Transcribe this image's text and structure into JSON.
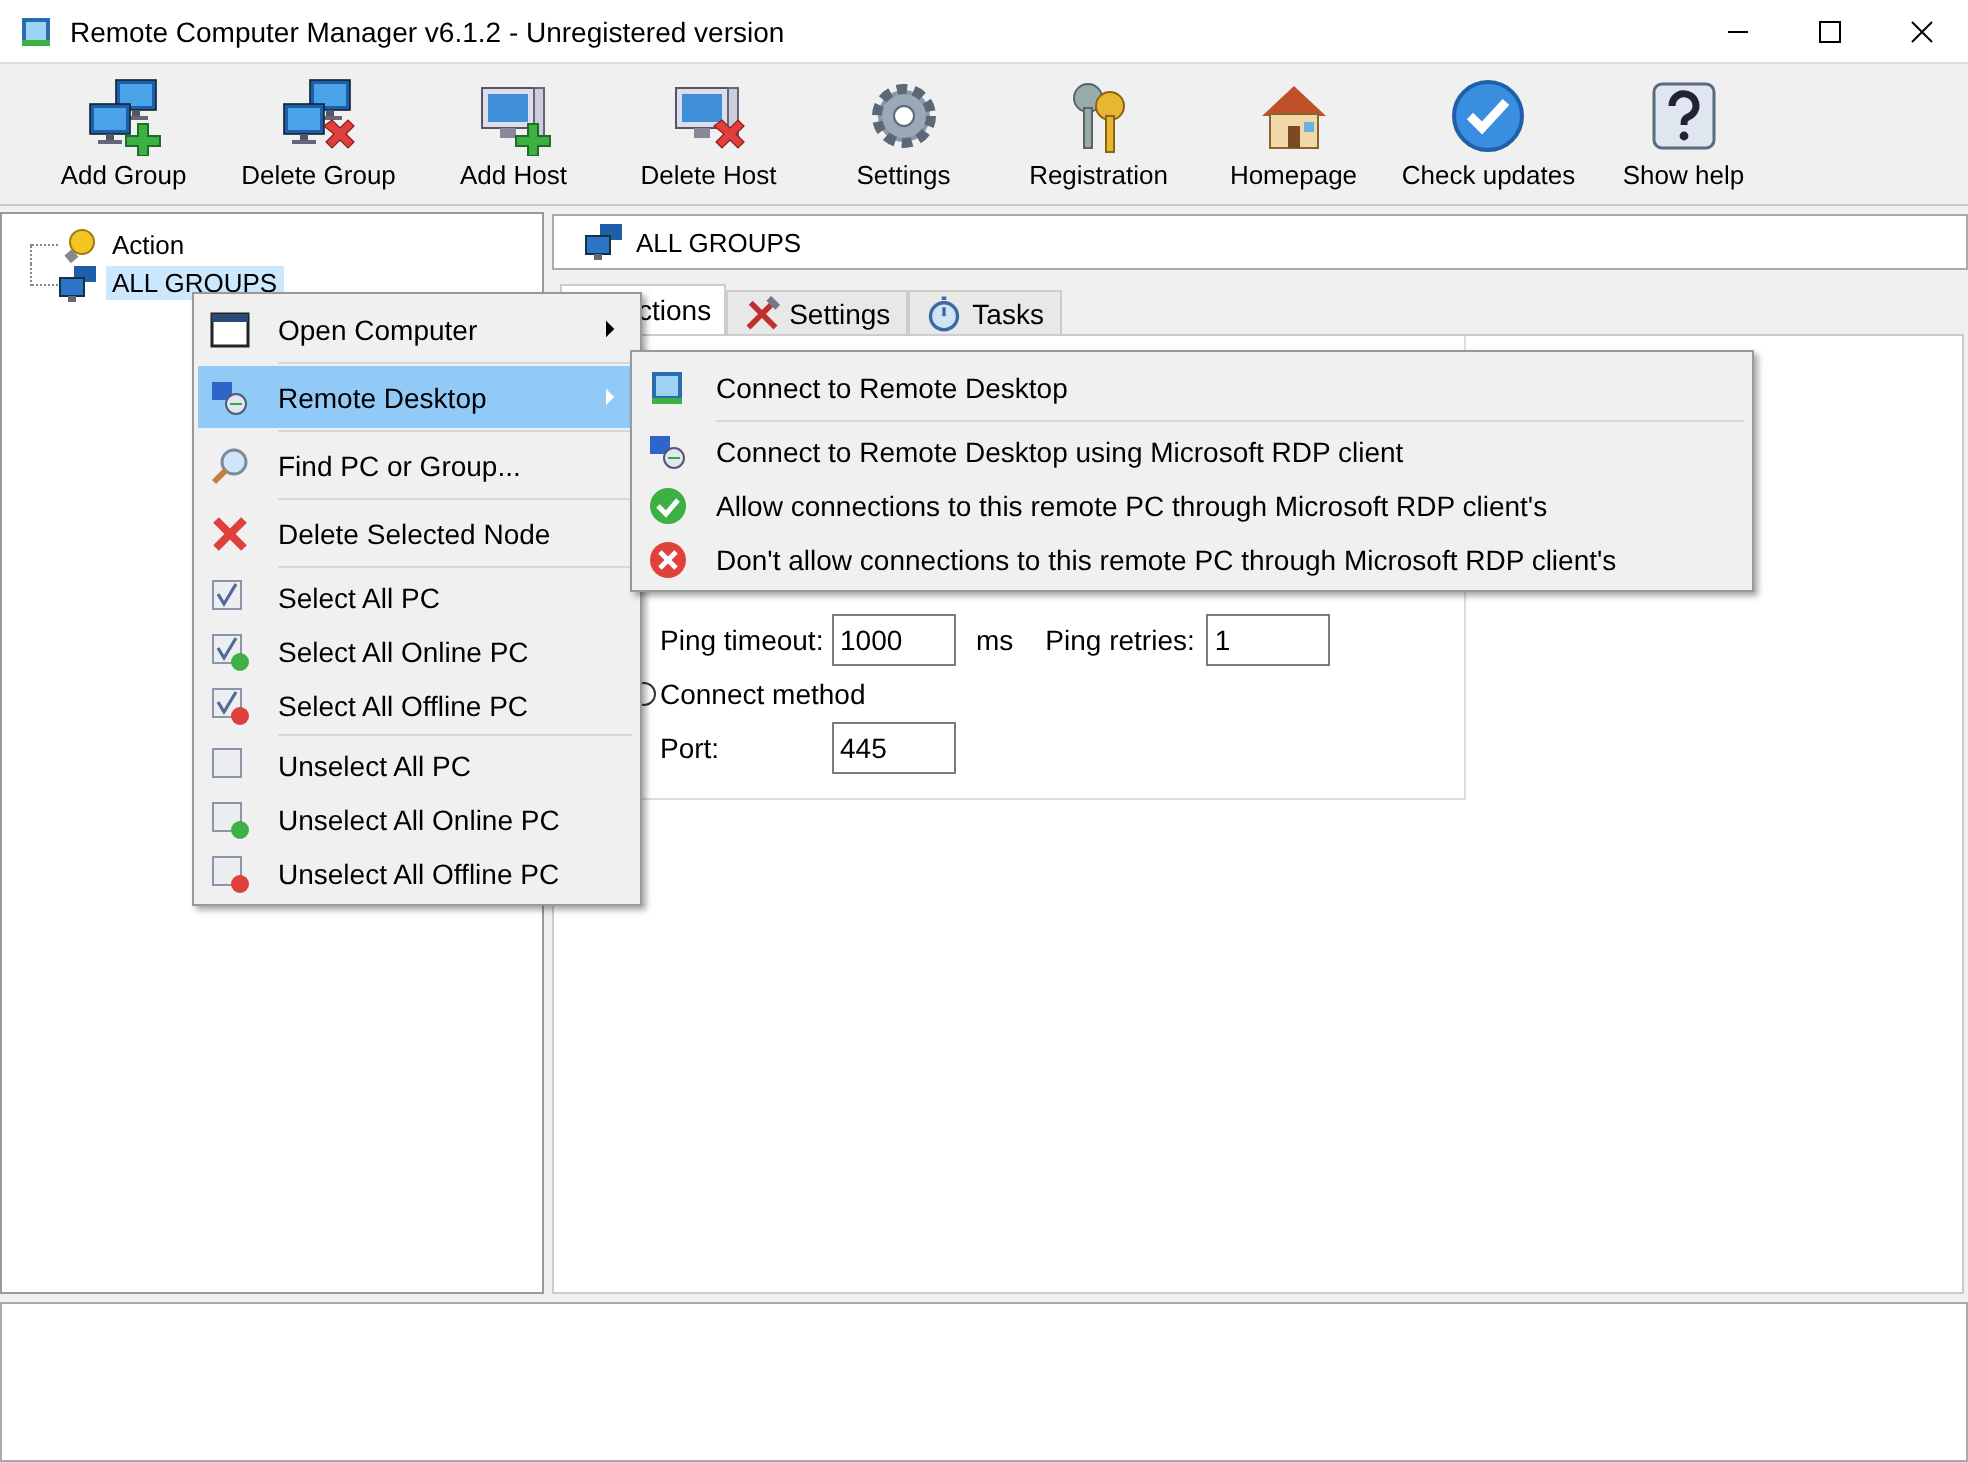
{
  "window": {
    "title": "Remote Computer Manager v6.1.2 - Unregistered version"
  },
  "toolbar": [
    {
      "label": "Add Group"
    },
    {
      "label": "Delete Group"
    },
    {
      "label": "Add Host"
    },
    {
      "label": "Delete Host"
    },
    {
      "label": "Settings"
    },
    {
      "label": "Registration"
    },
    {
      "label": "Homepage"
    },
    {
      "label": "Check updates"
    },
    {
      "label": "Show help"
    }
  ],
  "tree": {
    "items": [
      {
        "label": "Action",
        "selected": false
      },
      {
        "label": "ALL GROUPS",
        "selected": true
      }
    ]
  },
  "header": {
    "title": "ALL GROUPS"
  },
  "tabs": [
    {
      "label": "ctions",
      "selected": true
    },
    {
      "label": "Settings",
      "selected": false
    },
    {
      "label": "Tasks",
      "selected": false
    }
  ],
  "form": {
    "ping_timeout": {
      "label": "Ping timeout:",
      "value": "1000",
      "unit": "ms"
    },
    "ping_retries": {
      "label": "Ping retries:",
      "value": "1"
    },
    "connect_method": {
      "label": "Connect method",
      "selected": false
    },
    "port": {
      "label": "Port:",
      "value": "445"
    }
  },
  "context_menu": {
    "groups": [
      [
        {
          "kind": "item",
          "label": "Open Computer",
          "submenu": true,
          "selected": false
        }
      ],
      [
        {
          "kind": "item",
          "label": "Remote Desktop",
          "submenu": true,
          "selected": true
        }
      ],
      [
        {
          "kind": "item",
          "label": "Find PC or Group...",
          "submenu": false,
          "selected": false
        }
      ],
      [
        {
          "kind": "item",
          "label": "Delete Selected Node",
          "submenu": false,
          "selected": false
        }
      ],
      [
        {
          "kind": "checkbox",
          "label": "Select All PC",
          "checked": true,
          "selected": false
        },
        {
          "kind": "checkbox",
          "label": "Select All Online PC",
          "checked": true,
          "color": "#3cb043",
          "selected": false
        },
        {
          "kind": "checkbox",
          "label": "Select All Offline PC",
          "checked": true,
          "color": "#e0403c",
          "selected": false
        }
      ],
      [
        {
          "kind": "checkbox",
          "label": "Unselect All PC",
          "checked": false,
          "selected": false
        },
        {
          "kind": "checkbox",
          "label": "Unselect All Online PC",
          "checked": false,
          "color": "#3cb043",
          "selected": false
        },
        {
          "kind": "checkbox",
          "label": "Unselect All Offline PC",
          "checked": false,
          "color": "#e0403c",
          "selected": false
        }
      ]
    ]
  },
  "submenu": {
    "groups": [
      [
        {
          "label": "Connect to Remote Desktop",
          "selected": false
        }
      ],
      [
        {
          "label": "Connect to Remote Desktop using Microsoft RDP client",
          "selected": false
        },
        {
          "label": "Allow connections to this remote PC through Microsoft RDP client's",
          "selected": false
        },
        {
          "label": "Don't allow connections to this remote PC through Microsoft RDP client's",
          "selected": false
        }
      ]
    ]
  }
}
